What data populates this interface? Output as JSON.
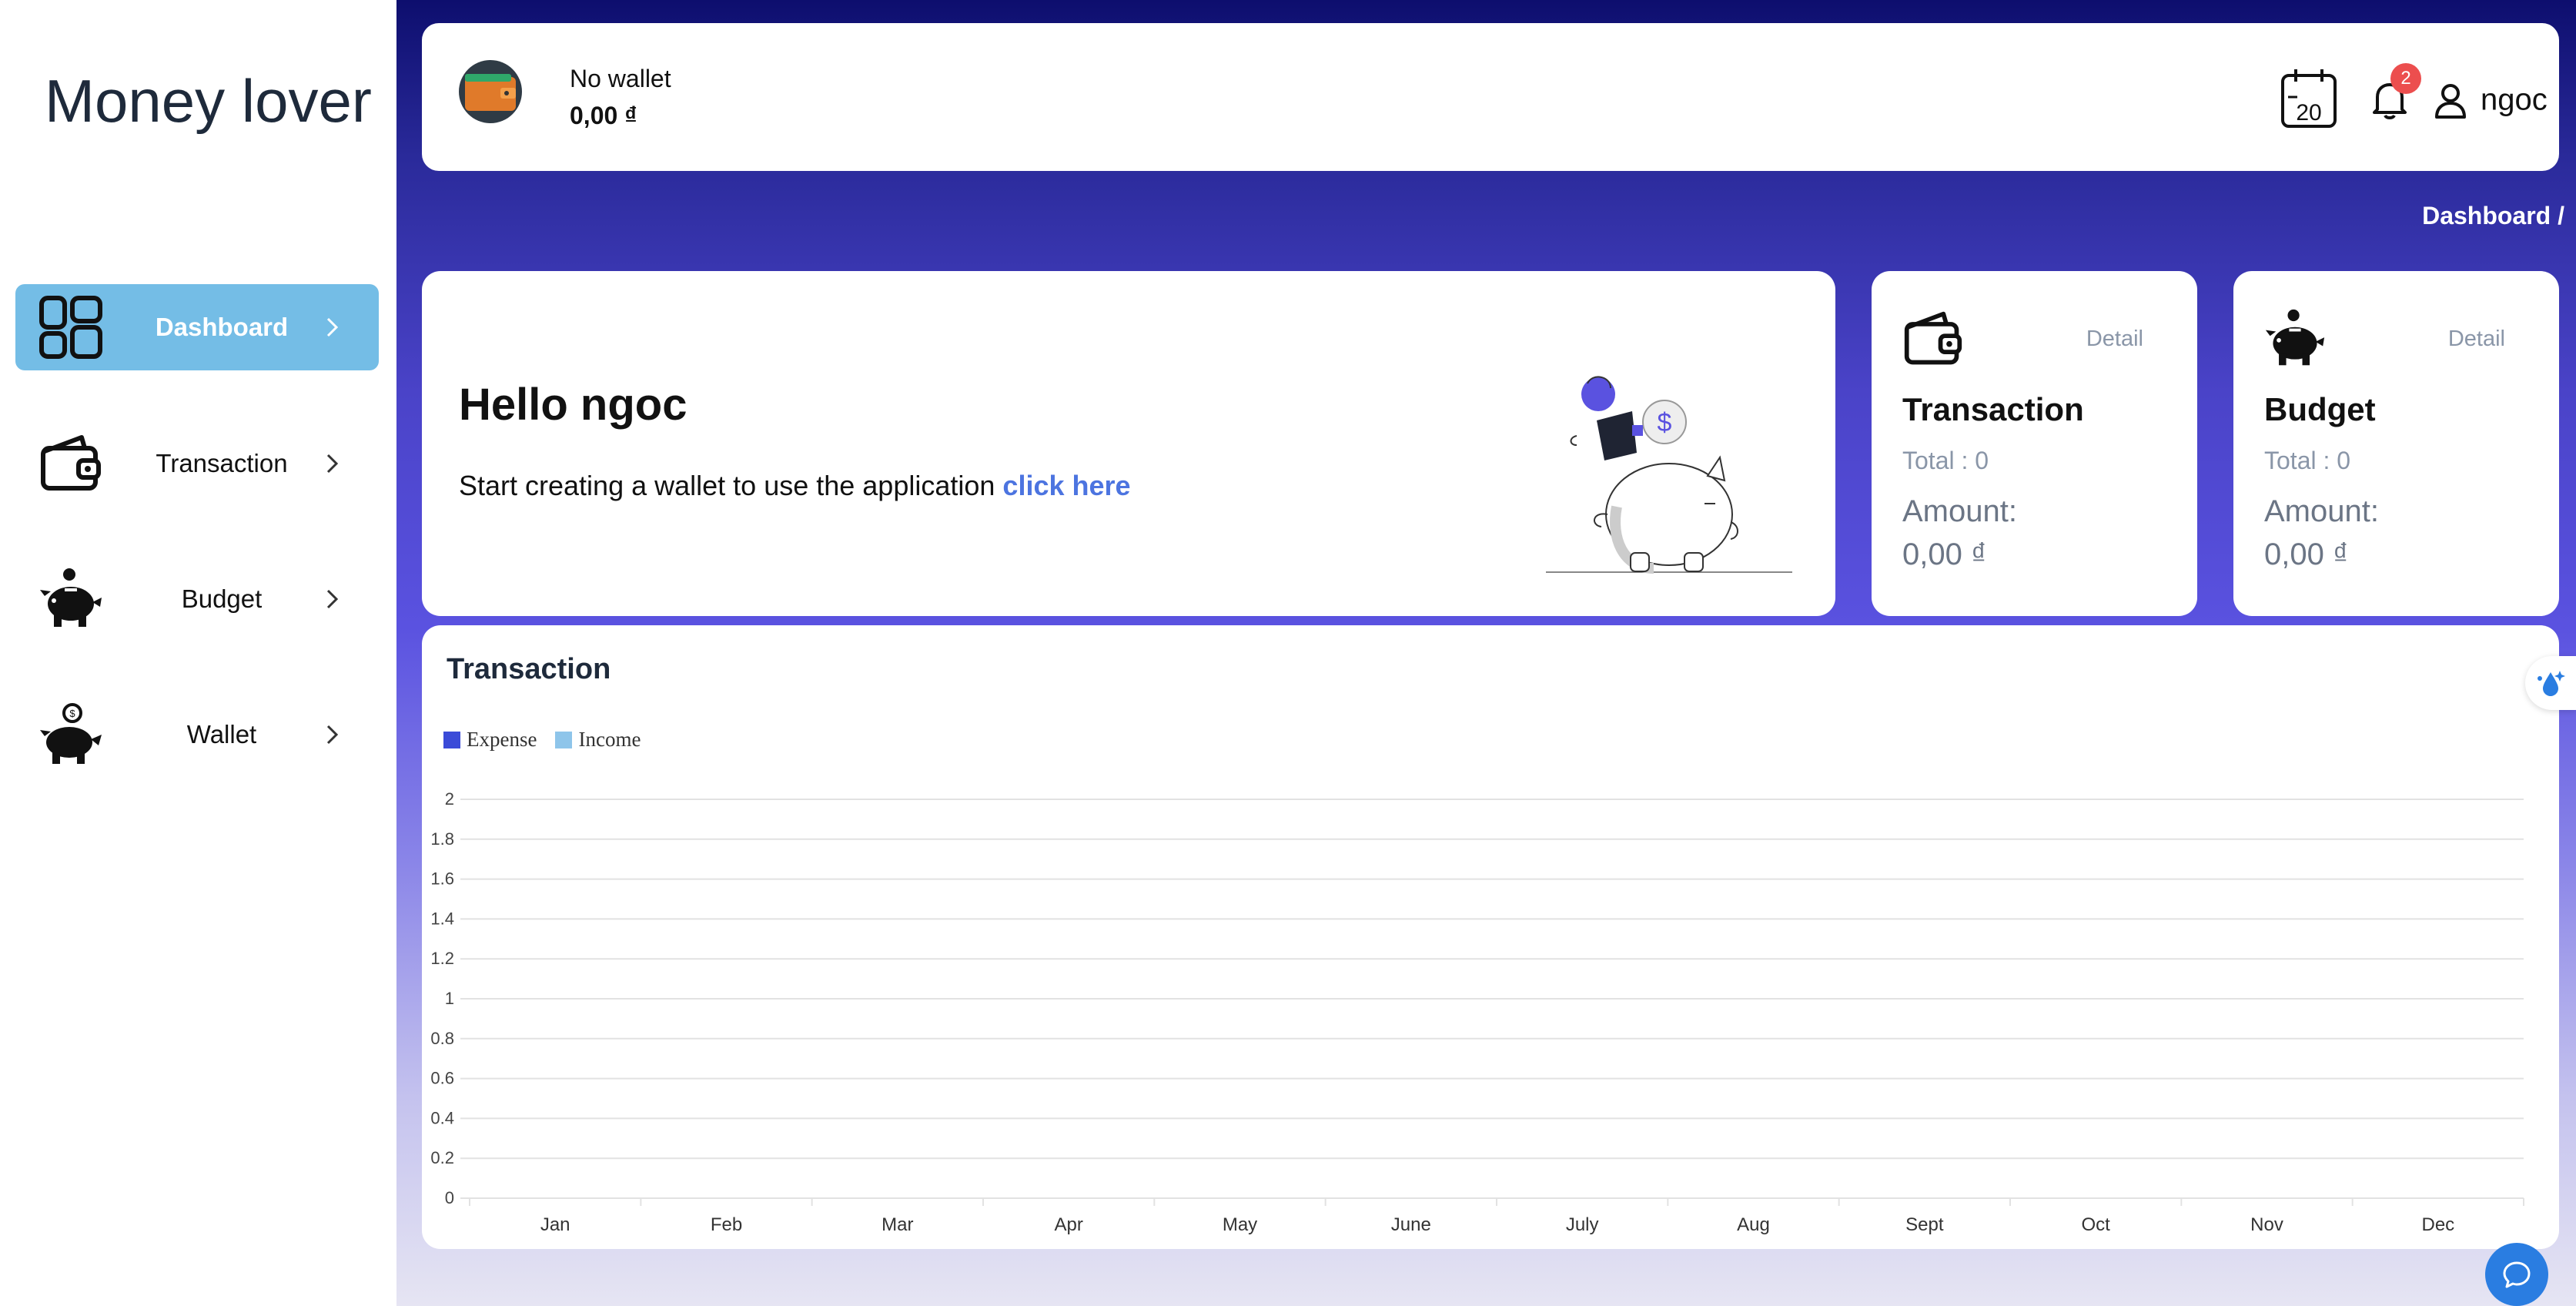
{
  "app": {
    "title": "Money lover"
  },
  "sidebar": {
    "items": [
      {
        "label": "Dashboard",
        "icon": "dashboard-icon",
        "active": true
      },
      {
        "label": "Transaction",
        "icon": "wallet-icon",
        "active": false
      },
      {
        "label": "Budget",
        "icon": "piggy-bank-icon",
        "active": false
      },
      {
        "label": "Wallet",
        "icon": "coin-piggy-icon",
        "active": false
      }
    ]
  },
  "header": {
    "wallet_name": "No wallet",
    "wallet_balance": "0,00 ₫",
    "calendar_day": "20",
    "notification_count": "2",
    "user_name": "ngoc"
  },
  "breadcrumb": "Dashboard /",
  "hello": {
    "title": "Hello ngoc",
    "text": "Start creating a wallet to use the application ",
    "link": "click here"
  },
  "cards": {
    "transaction": {
      "title": "Transaction",
      "detail": "Detail",
      "total": "Total : 0",
      "amount_label": "Amount:",
      "amount": "0,00 ₫"
    },
    "budget": {
      "title": "Budget",
      "detail": "Detail",
      "total": "Total : 0",
      "amount_label": "Amount:",
      "amount": "0,00 ₫"
    }
  },
  "colors": {
    "expense": "#3b4bd8",
    "income": "#8ec5ea",
    "active_nav": "#74bde6",
    "link": "#4c74e0",
    "badge": "#ec4e4e"
  },
  "chart_data": {
    "type": "bar",
    "title": "Transaction",
    "categories": [
      "Jan",
      "Feb",
      "Mar",
      "Apr",
      "May",
      "June",
      "July",
      "Aug",
      "Sept",
      "Oct",
      "Nov",
      "Dec"
    ],
    "series": [
      {
        "name": "Expense",
        "values": [
          0,
          0,
          0,
          0,
          0,
          0,
          0,
          0,
          0,
          0,
          0,
          0
        ]
      },
      {
        "name": "Income",
        "values": [
          0,
          0,
          0,
          0,
          0,
          0,
          0,
          0,
          0,
          0,
          0,
          0
        ]
      }
    ],
    "yticks": [
      "0",
      "0.2",
      "0.4",
      "0.6",
      "0.8",
      "1",
      "1.2",
      "1.4",
      "1.6",
      "1.8",
      "2"
    ],
    "ylim": [
      0,
      2
    ],
    "legend_position": "top-left",
    "grid": true
  }
}
